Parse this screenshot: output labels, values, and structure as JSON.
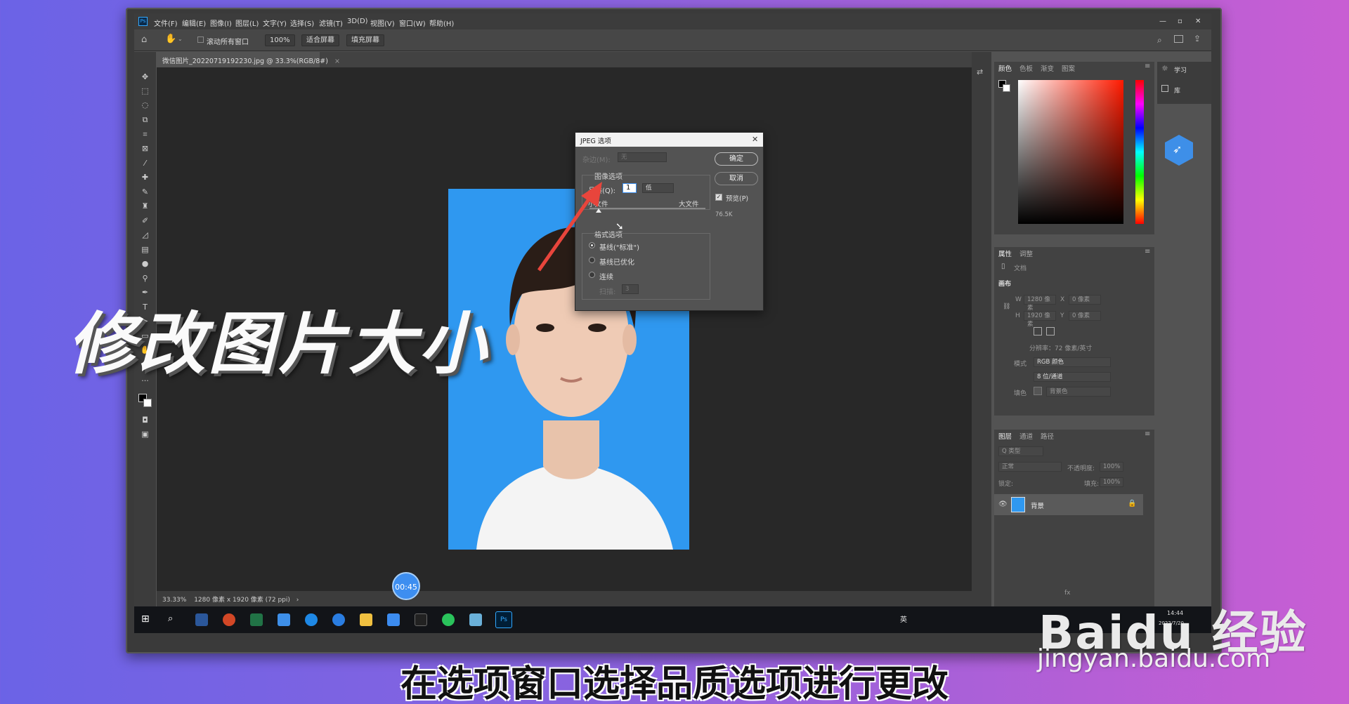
{
  "app": {
    "menu": [
      "文件(F)",
      "编辑(E)",
      "图像(I)",
      "图层(L)",
      "文字(Y)",
      "选择(S)",
      "滤镜(T)",
      "3D(D)",
      "视图(V)",
      "窗口(W)",
      "帮助(H)"
    ],
    "window_controls": [
      "—",
      "▫",
      "✕"
    ]
  },
  "options_bar": {
    "scroll_all_label": "滚动所有窗口",
    "zoom_value": "100%",
    "fit_screen": "适合屏幕",
    "fill_screen": "填充屏幕"
  },
  "document": {
    "tab_title": "微信图片_20220719192230.jpg @ 33.3%(RGB/8#)",
    "tab_close": "×"
  },
  "status_bar": {
    "zoom": "33.33%",
    "info": "1280 像素 x 1920 像素 (72 ppi)",
    "arrow": "›"
  },
  "dialog": {
    "title": "JPEG 选项",
    "close": "✕",
    "matte_label": "杂边(M):",
    "matte_value": "无",
    "image_options": "图像选项",
    "quality_label": "品质(Q):",
    "quality_value": "1",
    "quality_preset": "低",
    "small_file": "小文件",
    "large_file": "大文件",
    "quality_fraction": 0.08,
    "format_options": "格式选项",
    "baseline_standard": "基线(\"标准\")",
    "baseline_optimized": "基线已优化",
    "progressive": "连续",
    "scans_label": "扫描:",
    "scans_value": "3",
    "ok": "确定",
    "cancel": "取消",
    "preview_label": "预览(P)",
    "file_size": "76.5K"
  },
  "panels": {
    "color_tabs": [
      "颜色",
      "色板",
      "渐变",
      "图案"
    ],
    "learn": "学习",
    "library": "库",
    "props_tabs": [
      "属性",
      "调整"
    ],
    "doc_label": "文档",
    "canvas_section": "画布",
    "w_label": "W",
    "w_value": "1280 像素",
    "x_label": "X",
    "x_value": "0 像素",
    "h_label": "H",
    "h_value": "1920 像素",
    "y_label": "Y",
    "y_value": "0 像素",
    "resolution": "分辨率：72 像素/英寸",
    "mode_label": "模式",
    "mode_value": "RGB 颜色",
    "depth_value": "8 位/通道",
    "fill_label": "填色",
    "fill_value": "背景色",
    "layers_tabs": [
      "图层",
      "通道",
      "路径"
    ],
    "layer_filter": "Q 类型",
    "blend_mode": "正常",
    "opacity_label": "不透明度:",
    "opacity_value": "100%",
    "lock_label": "锁定:",
    "fill_pct_label": "填充:",
    "fill_pct_value": "100%",
    "layer_name": "背景",
    "fx": "fx"
  },
  "taskbar": {
    "ps": "Ps",
    "lang": "英",
    "time": "14:44",
    "date": "2022/7/20"
  },
  "overlay": {
    "title": "修改图片大小",
    "subtitle": "在选项窗口选择品质选项进行更改",
    "timer": "00:45",
    "watermark": "Baidu 经验",
    "watermark_url": "jingyan.baidu.com"
  },
  "colors": {
    "photo_bg": "#2f98f0",
    "accent": "#3d8ef0",
    "arrow": "#e8453c"
  }
}
